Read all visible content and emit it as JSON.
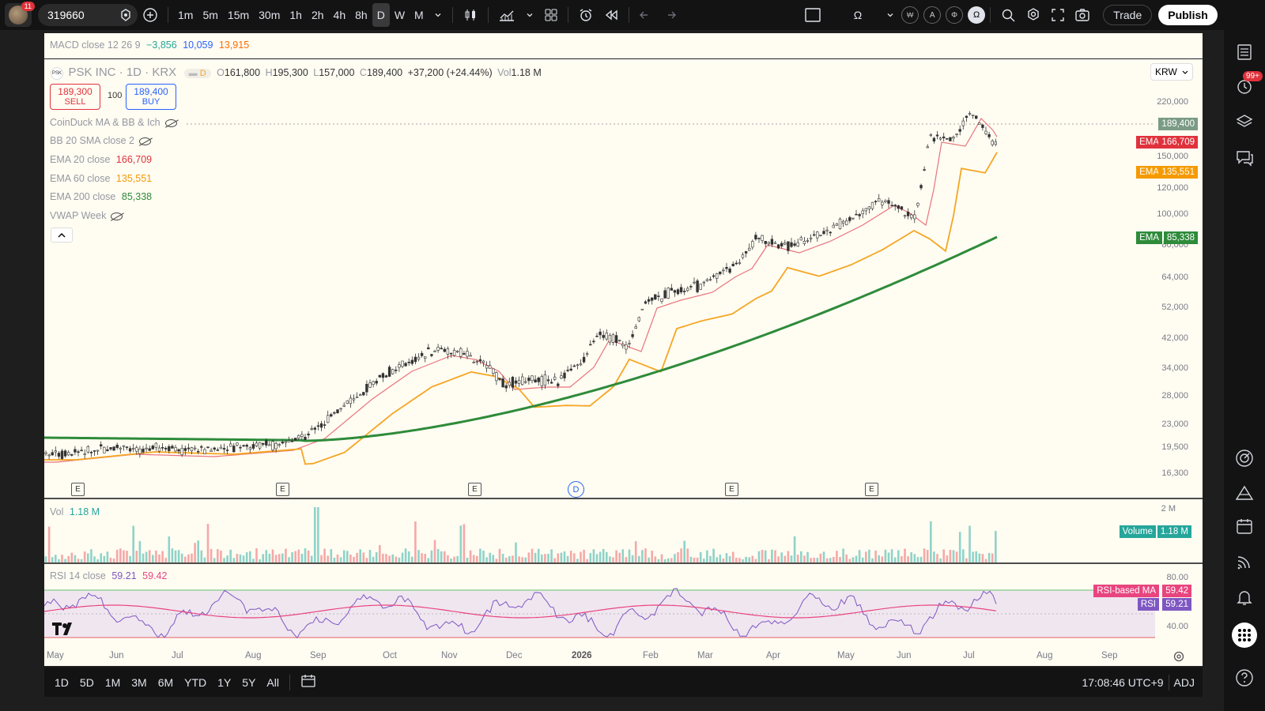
{
  "topbar": {
    "notification_count": "11",
    "symbol": "319660",
    "intervals": [
      "1m",
      "5m",
      "15m",
      "30m",
      "1h",
      "2h",
      "4h",
      "8h",
      "D",
      "W",
      "M"
    ],
    "active_interval": "D",
    "trade_label": "Trade",
    "publish_label": "Publish",
    "omega": "Ω",
    "chip_a": "A",
    "chip_b": "Φ",
    "chip_c": "Ω",
    "chip_d": "₩"
  },
  "indicator_header": {
    "macd_label": "MACD close 12 26 9",
    "macd_v1": "−3,856",
    "macd_v2": "10,059",
    "macd_v3": "13,915"
  },
  "symbol_info": {
    "name": "PSK INC · 1D · KRX",
    "flag": "D",
    "open_label": "O",
    "open": "161,800",
    "high_label": "H",
    "high": "195,300",
    "low_label": "L",
    "low": "157,000",
    "close_label": "C",
    "close": "189,400",
    "change": "+37,200 (+24.44%)",
    "vol_label": "Vol",
    "vol": "1.18 M",
    "currency": "KRW"
  },
  "order": {
    "sell_price": "189,300",
    "sell_label": "SELL",
    "qty": "100",
    "buy_price": "189,400",
    "buy_label": "BUY"
  },
  "legend": {
    "coinduck": "CoinDuck MA & BB & Ich",
    "bb": "BB 20 SMA close 2",
    "ema20_label": "EMA 20 close",
    "ema20_value": "166,709",
    "ema60_label": "EMA 60 close",
    "ema60_value": "135,551",
    "ema200_label": "EMA 200 close",
    "ema200_value": "85,338",
    "vwap": "VWAP Week"
  },
  "price_axis": [
    "220,000",
    "150,000",
    "120,000",
    "100,000",
    "80,000",
    "64,000",
    "52,000",
    "42,000",
    "34,000",
    "28,000",
    "23,000",
    "19,500",
    "16,300"
  ],
  "price_tags": {
    "last": "189,400",
    "ema_label": "EMA",
    "ema20": "166,709",
    "ema60": "135,551",
    "ema200": "85,338"
  },
  "volume_pane": {
    "label": "Vol",
    "value": "1.18 M",
    "axis": "2 M",
    "tag_label": "Volume",
    "tag_value": "1.18 M"
  },
  "rsi_pane": {
    "label": "RSI 14 close",
    "v1": "59.21",
    "v2": "59.42",
    "axis_top": "80.00",
    "axis_bottom": "40.00",
    "ma_tag_label": "RSI-based MA",
    "ma_tag_value": "59.42",
    "rsi_tag_label": "RSI",
    "rsi_tag_value": "59.21"
  },
  "time_axis": [
    "May",
    "Jun",
    "Jul",
    "Aug",
    "Sep",
    "Oct",
    "Nov",
    "Dec",
    "2026",
    "Feb",
    "Mar",
    "Apr",
    "May",
    "Jun",
    "Jul",
    "Aug",
    "Sep"
  ],
  "event_marks": [
    "E",
    "E",
    "E",
    "D",
    "E",
    "E"
  ],
  "bottombar": {
    "ranges": [
      "1D",
      "5D",
      "1M",
      "3M",
      "6M",
      "YTD",
      "1Y",
      "5Y",
      "All"
    ],
    "clock": "17:08:46 UTC+9",
    "adj": "ADJ"
  },
  "sidebar": {
    "badge": "99+"
  },
  "colors": {
    "ema20": "#e8737b",
    "ema60": "#f5a623",
    "ema200": "#2e8b3a",
    "up": "#2e8b3a",
    "down": "#e0323c",
    "rsi": "#7e57c2",
    "rsi_ma": "#e8457f"
  }
}
